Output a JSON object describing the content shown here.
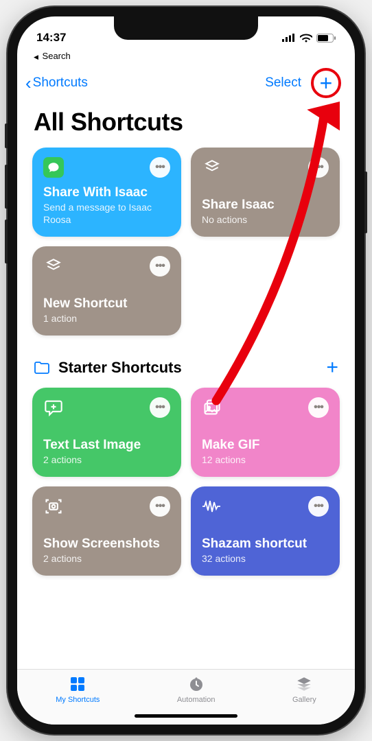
{
  "status": {
    "time": "14:37",
    "return_app": "Search"
  },
  "nav": {
    "back": "Shortcuts",
    "select": "Select"
  },
  "title": "All Shortcuts",
  "top_cards": [
    {
      "title": "Share With Isaac",
      "sub": "Send a message to Isaac Roosa",
      "bg": "bg-blue",
      "icon": "messages"
    },
    {
      "title": "Share Isaac",
      "sub": "No actions",
      "bg": "bg-brown",
      "icon": "stack"
    },
    {
      "title": "New Shortcut",
      "sub": "1 action",
      "bg": "bg-brown",
      "icon": "stack"
    }
  ],
  "section": {
    "title": "Starter Shortcuts"
  },
  "starter_cards": [
    {
      "title": "Text Last Image",
      "sub": "2 actions",
      "bg": "bg-green",
      "icon": "text"
    },
    {
      "title": "Make GIF",
      "sub": "12 actions",
      "bg": "bg-pink",
      "icon": "photos"
    },
    {
      "title": "Show Screenshots",
      "sub": "2 actions",
      "bg": "bg-brown",
      "icon": "capture"
    },
    {
      "title": "Shazam shortcut",
      "sub": "32 actions",
      "bg": "bg-indigo",
      "icon": "wave"
    }
  ],
  "tabs": [
    {
      "label": "My Shortcuts",
      "active": true
    },
    {
      "label": "Automation",
      "active": false
    },
    {
      "label": "Gallery",
      "active": false
    }
  ],
  "colors": {
    "tint": "#007aff",
    "annotation": "#e8000d"
  }
}
